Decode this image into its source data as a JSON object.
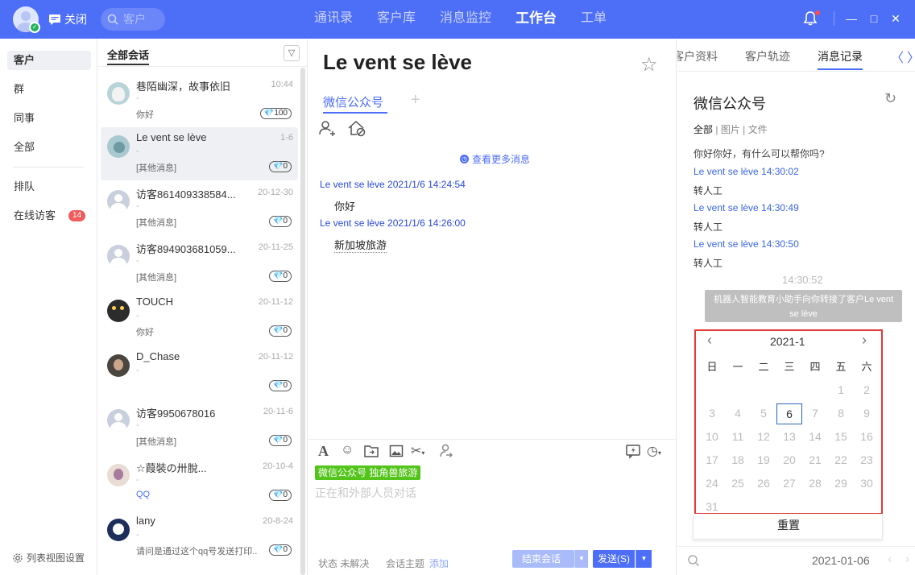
{
  "topbar": {
    "close_label": "关闭",
    "search_placeholder": "客户",
    "nav": [
      "通讯录",
      "客户库",
      "消息监控",
      "工作台",
      "工单"
    ],
    "nav_active": "工作台"
  },
  "leftnav": {
    "items": [
      "客户",
      "群",
      "同事",
      "全部"
    ],
    "items2": [
      "排队",
      "在线访客"
    ],
    "online_count": "14",
    "bottom_label": "列表视图设置"
  },
  "convlist": {
    "title": "全部会话",
    "items": [
      {
        "name": "巷陌幽深，故事依旧",
        "time": "10:44",
        "dash": "-",
        "sub": "你好",
        "count": "100"
      },
      {
        "name": "Le vent se lève",
        "time": "1-6",
        "dash": "-",
        "sub": "[其他消息]",
        "count": "0"
      },
      {
        "name": "访客861409338584...",
        "time": "20-12-30",
        "dash": "-",
        "sub": "[其他消息]",
        "count": "0"
      },
      {
        "name": "访客894903681059...",
        "time": "20-11-25",
        "dash": "-",
        "sub": "[其他消息]",
        "count": "0"
      },
      {
        "name": "TOUCH",
        "time": "20-11-12",
        "dash": "-",
        "sub": "你好",
        "count": "0"
      },
      {
        "name": "D_Chase",
        "time": "20-11-12",
        "dash": "-",
        "sub": "",
        "count": "0"
      },
      {
        "name": "访客9950678016",
        "time": "20-11-6",
        "dash": "-",
        "sub": "[其他消息]",
        "count": "0"
      },
      {
        "name": "☆葭裝の卅脫...",
        "time": "20-10-4",
        "dash": "-",
        "sub": "QQ",
        "count": "0"
      },
      {
        "name": "lany",
        "time": "20-8-24",
        "dash": "-",
        "sub": "请问是通过这个qq号发送打印...",
        "count": "0"
      }
    ]
  },
  "chat": {
    "title": "Le vent se lève",
    "tab": "微信公众号",
    "more_messages": "查看更多消息",
    "messages": [
      {
        "meta": "Le vent se lève 2021/1/6 14:24:54",
        "text": "你好"
      },
      {
        "meta": "Le vent se lève 2021/1/6 14:26:00",
        "text": "新加坡旅游"
      }
    ],
    "channel_chip": "微信公众号 独角兽旅游",
    "placeholder": "正在和外部人员对话",
    "status_label": "状态",
    "status_value": "未解决",
    "topic_label": "会话主题",
    "topic_add": "添加",
    "end_button": "结束会话",
    "send_button": "发送(S)"
  },
  "right": {
    "tabs": [
      "客户资料",
      "客户轨迹",
      "消息记录"
    ],
    "tab_active": "消息记录",
    "title": "微信公众号",
    "filters": [
      "全部",
      "图片",
      "文件"
    ],
    "first_line": "你好你好，有什么可以帮你吗?",
    "records": [
      {
        "meta": "Le vent se lève 14:30:02",
        "text": "转人工"
      },
      {
        "meta": "Le vent se lève 14:30:49",
        "text": "转人工"
      },
      {
        "meta": "Le vent se lève 14:30:50",
        "text": "转人工"
      }
    ],
    "timestamp": "14:30:52",
    "system_msg": "机器人智能教育小助手向你转接了客户Le vent se lève",
    "calendar": {
      "month": "2021-1",
      "weekdays": [
        "日",
        "一",
        "二",
        "三",
        "四",
        "五",
        "六"
      ],
      "selected_day": 6,
      "reset": "重置"
    },
    "date_value": "2021-01-06"
  }
}
